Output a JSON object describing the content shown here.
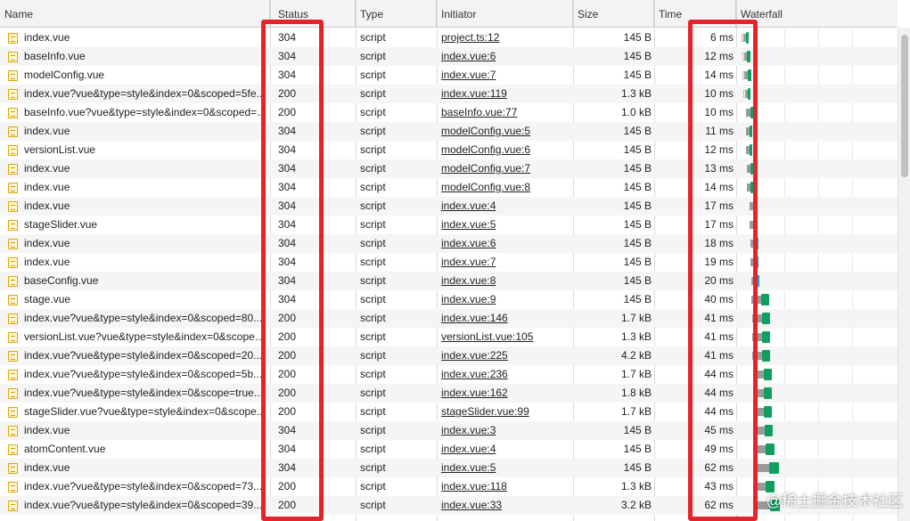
{
  "columns": {
    "name": "Name",
    "status": "Status",
    "type": "Type",
    "initiator": "Initiator",
    "size": "Size",
    "time": "Time",
    "waterfall": "Waterfall"
  },
  "rows": [
    {
      "name": "index.vue",
      "status": "304",
      "type": "script",
      "initiator": "project.ts:12",
      "size": "145 B",
      "time": "6 ms"
    },
    {
      "name": "baseInfo.vue",
      "status": "304",
      "type": "script",
      "initiator": "index.vue:6",
      "size": "145 B",
      "time": "12 ms"
    },
    {
      "name": "modelConfig.vue",
      "status": "304",
      "type": "script",
      "initiator": "index.vue:7",
      "size": "145 B",
      "time": "14 ms"
    },
    {
      "name": "index.vue?vue&type=style&index=0&scoped=5fe...",
      "status": "200",
      "type": "script",
      "initiator": "index.vue:119",
      "size": "1.3 kB",
      "time": "10 ms"
    },
    {
      "name": "baseInfo.vue?vue&type=style&index=0&scoped=...",
      "status": "200",
      "type": "script",
      "initiator": "baseInfo.vue:77",
      "size": "1.0 kB",
      "time": "10 ms"
    },
    {
      "name": "index.vue",
      "status": "304",
      "type": "script",
      "initiator": "modelConfig.vue:5",
      "size": "145 B",
      "time": "11 ms"
    },
    {
      "name": "versionList.vue",
      "status": "304",
      "type": "script",
      "initiator": "modelConfig.vue:6",
      "size": "145 B",
      "time": "12 ms"
    },
    {
      "name": "index.vue",
      "status": "304",
      "type": "script",
      "initiator": "modelConfig.vue:7",
      "size": "145 B",
      "time": "13 ms"
    },
    {
      "name": "index.vue",
      "status": "304",
      "type": "script",
      "initiator": "modelConfig.vue:8",
      "size": "145 B",
      "time": "14 ms"
    },
    {
      "name": "index.vue",
      "status": "304",
      "type": "script",
      "initiator": "index.vue:4",
      "size": "145 B",
      "time": "17 ms"
    },
    {
      "name": "stageSlider.vue",
      "status": "304",
      "type": "script",
      "initiator": "index.vue:5",
      "size": "145 B",
      "time": "17 ms"
    },
    {
      "name": "index.vue",
      "status": "304",
      "type": "script",
      "initiator": "index.vue:6",
      "size": "145 B",
      "time": "18 ms"
    },
    {
      "name": "index.vue",
      "status": "304",
      "type": "script",
      "initiator": "index.vue:7",
      "size": "145 B",
      "time": "19 ms"
    },
    {
      "name": "baseConfig.vue",
      "status": "304",
      "type": "script",
      "initiator": "index.vue:8",
      "size": "145 B",
      "time": "20 ms"
    },
    {
      "name": "stage.vue",
      "status": "304",
      "type": "script",
      "initiator": "index.vue:9",
      "size": "145 B",
      "time": "40 ms"
    },
    {
      "name": "index.vue?vue&type=style&index=0&scoped=80...",
      "status": "200",
      "type": "script",
      "initiator": "index.vue:146",
      "size": "1.7 kB",
      "time": "41 ms"
    },
    {
      "name": "versionList.vue?vue&type=style&index=0&scoped...",
      "status": "200",
      "type": "script",
      "initiator": "versionList.vue:105",
      "size": "1.3 kB",
      "time": "41 ms"
    },
    {
      "name": "index.vue?vue&type=style&index=0&scoped=20...",
      "status": "200",
      "type": "script",
      "initiator": "index.vue:225",
      "size": "4.2 kB",
      "time": "41 ms"
    },
    {
      "name": "index.vue?vue&type=style&index=0&scoped=5b...",
      "status": "200",
      "type": "script",
      "initiator": "index.vue:236",
      "size": "1.7 kB",
      "time": "44 ms"
    },
    {
      "name": "index.vue?vue&type=style&index=0&scope=true...",
      "status": "200",
      "type": "script",
      "initiator": "index.vue:162",
      "size": "1.8 kB",
      "time": "44 ms"
    },
    {
      "name": "stageSlider.vue?vue&type=style&index=0&scope...",
      "status": "200",
      "type": "script",
      "initiator": "stageSlider.vue:99",
      "size": "1.7 kB",
      "time": "44 ms"
    },
    {
      "name": "index.vue",
      "status": "304",
      "type": "script",
      "initiator": "index.vue:3",
      "size": "145 B",
      "time": "45 ms"
    },
    {
      "name": "atomContent.vue",
      "status": "304",
      "type": "script",
      "initiator": "index.vue:4",
      "size": "145 B",
      "time": "49 ms"
    },
    {
      "name": "index.vue",
      "status": "304",
      "type": "script",
      "initiator": "index.vue:5",
      "size": "145 B",
      "time": "62 ms"
    },
    {
      "name": "index.vue?vue&type=style&index=0&scoped=73...",
      "status": "200",
      "type": "script",
      "initiator": "index.vue:118",
      "size": "1.3 kB",
      "time": "43 ms"
    },
    {
      "name": "index.vue?vue&type=style&index=0&scoped=39...",
      "status": "200",
      "type": "script",
      "initiator": "index.vue:33",
      "size": "3.2 kB",
      "time": "62 ms"
    }
  ],
  "waterfall": [
    {
      "start": 2,
      "wait": 3,
      "recv": 3,
      "ghost": true
    },
    {
      "start": 3,
      "wait": 3,
      "recv": 4,
      "ghost": true
    },
    {
      "start": 3,
      "wait": 4,
      "recv": 4,
      "ghost": true
    },
    {
      "start": 4,
      "wait": 3,
      "recv": 3,
      "ghost": true
    },
    {
      "start": 5,
      "wait": 5,
      "recv": 4,
      "ghost": false
    },
    {
      "start": 5,
      "wait": 4,
      "recv": 3,
      "ghost": false
    },
    {
      "start": 5,
      "wait": 4,
      "recv": 3,
      "ghost": false
    },
    {
      "start": 6,
      "wait": 4,
      "recv": 3,
      "ghost": false
    },
    {
      "start": 6,
      "wait": 4,
      "recv": 3,
      "ghost": false
    },
    {
      "start": 9,
      "wait": 5,
      "recv": 4,
      "ghost": false,
      "blue": true
    },
    {
      "start": 9,
      "wait": 5,
      "recv": 4,
      "ghost": false,
      "blue": true
    },
    {
      "start": 10,
      "wait": 5,
      "recv": 4,
      "ghost": false,
      "blue": true
    },
    {
      "start": 10,
      "wait": 5,
      "recv": 4,
      "ghost": false,
      "blue": true
    },
    {
      "start": 11,
      "wait": 5,
      "recv": 4,
      "ghost": false,
      "blue": true
    },
    {
      "start": 11,
      "wait": 10,
      "recv": 9,
      "ghost": false
    },
    {
      "start": 12,
      "wait": 10,
      "recv": 9,
      "ghost": false
    },
    {
      "start": 12,
      "wait": 10,
      "recv": 9,
      "ghost": false
    },
    {
      "start": 12,
      "wait": 10,
      "recv": 9,
      "ghost": false
    },
    {
      "start": 13,
      "wait": 11,
      "recv": 9,
      "ghost": false
    },
    {
      "start": 13,
      "wait": 11,
      "recv": 9,
      "ghost": false
    },
    {
      "start": 13,
      "wait": 11,
      "recv": 9,
      "ghost": false
    },
    {
      "start": 14,
      "wait": 11,
      "recv": 9,
      "ghost": false
    },
    {
      "start": 14,
      "wait": 12,
      "recv": 10,
      "ghost": false
    },
    {
      "start": 14,
      "wait": 16,
      "recv": 11,
      "ghost": false
    },
    {
      "start": 14,
      "wait": 12,
      "recv": 10,
      "ghost": false
    },
    {
      "start": 15,
      "wait": 16,
      "recv": 11,
      "ghost": false
    }
  ],
  "watermark": "@稀土掘金技术社区",
  "colors": {
    "highlight": "#e3242b",
    "receive": "#0fa060",
    "waiting": "#9a9a9a"
  }
}
